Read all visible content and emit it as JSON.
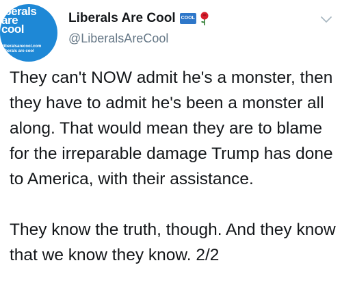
{
  "tweet": {
    "avatar": {
      "logo_text_big": "liberals\nare\ncool",
      "logo_text_small": "liberalsarecool.com\nliberals are cool"
    },
    "author": {
      "display_name": "Liberals Are Cool",
      "badge_text": "COOL",
      "handle": "@LiberalsAreCool"
    },
    "paragraphs": [
      "They can't NOW admit he's a monster, then they have to admit he's been a monster all along. That would mean they are to blame for the irreparable damage Trump has done to America, with their assistance.",
      "They know the truth, though. And they know that we know they know. 2/2"
    ],
    "icons": {
      "rose": "rose-icon",
      "menu": "chevron-down-icon"
    },
    "colors": {
      "text": "#14171a",
      "secondary": "#657786",
      "avatar_bg": "#1e88d6",
      "badge_bg": "#2e77c9",
      "rose": "#d81e2c"
    }
  }
}
